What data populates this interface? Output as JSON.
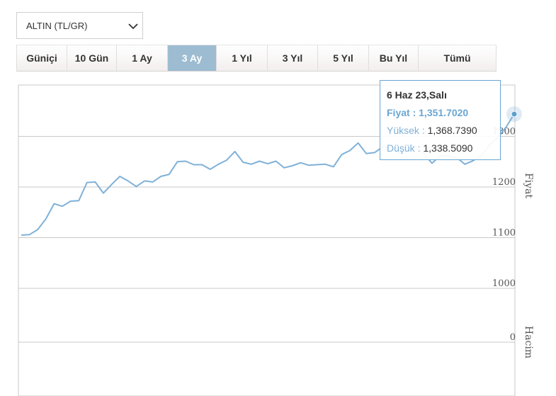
{
  "selector": {
    "value": "ALTIN (TL/GR)",
    "icon": "chevron-down-icon"
  },
  "tabs": [
    {
      "label": "Güniçi",
      "active": false
    },
    {
      "label": "10 Gün",
      "active": false
    },
    {
      "label": "1 Ay",
      "active": false
    },
    {
      "label": "3 Ay",
      "active": true
    },
    {
      "label": "1 Yıl",
      "active": false
    },
    {
      "label": "3 Yıl",
      "active": false
    },
    {
      "label": "5 Yıl",
      "active": false
    },
    {
      "label": "Bu Yıl",
      "active": false
    },
    {
      "label": "Tümü",
      "active": false
    }
  ],
  "tooltip": {
    "title": "6 Haz 23,Salı",
    "price_label": "Fiyat",
    "price_value": "1,351.7020",
    "high_label": "Yüksek",
    "high_value": "1,368.7390",
    "low_label": "Düşük",
    "low_value": "1,338.5090"
  },
  "colors": {
    "line": "#7fb1d8",
    "active_tab": "#9dbcd2",
    "grid": "#c8c8c8"
  },
  "chart_data": {
    "type": "line",
    "price_axis": {
      "label": "Fiyat",
      "ticks": [
        "1300",
        "1200",
        "1100",
        "1000"
      ],
      "range": [
        960,
        1340
      ]
    },
    "volume_axis": {
      "label": "Hacim",
      "ticks": [
        "0"
      ]
    },
    "grid": true,
    "series": [
      {
        "values": [
          1105,
          1106,
          1116,
          1137,
          1167,
          1162,
          1172,
          1173,
          1209,
          1210,
          1188,
          1205,
          1221,
          1212,
          1201,
          1212,
          1210,
          1221,
          1225,
          1250,
          1251,
          1244,
          1244,
          1235,
          1245,
          1253,
          1270,
          1249,
          1245,
          1251,
          1246,
          1251,
          1238,
          1242,
          1248,
          1243,
          1244,
          1245,
          1240,
          1264,
          1272,
          1287,
          1266,
          1268,
          1279,
          1278,
          1268,
          1271,
          1279,
          1265,
          1247,
          1262,
          1261,
          1258,
          1245,
          1252,
          1262,
          1283,
          1298,
          1318,
          1344
        ]
      }
    ]
  }
}
